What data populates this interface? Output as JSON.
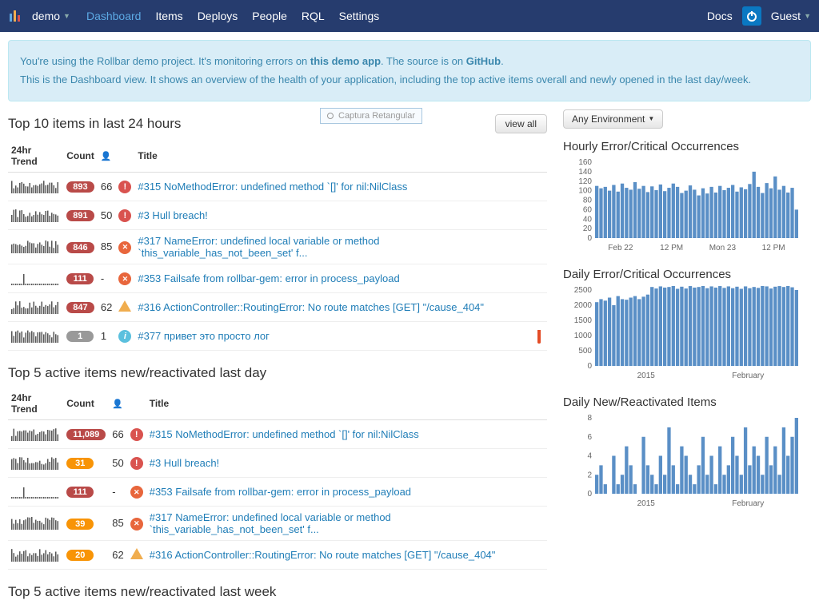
{
  "nav": {
    "project": "demo",
    "links": [
      "Dashboard",
      "Items",
      "Deploys",
      "People",
      "RQL",
      "Settings"
    ],
    "active": "Dashboard",
    "docs": "Docs",
    "user": "Guest"
  },
  "banner": {
    "line1_pre": "You're using the Rollbar demo project. It's monitoring errors on ",
    "line1_link1": "this demo app",
    "line1_mid": ". The source is on ",
    "line1_link2": "GitHub",
    "line1_post": ".",
    "line2": "This is the Dashboard view. It shows an overview of the health of your application, including the top active items overall and newly opened in the last day/week."
  },
  "capture_box": "Captura Retangular",
  "sections": {
    "top10_title": "Top 10 items in last 24 hours",
    "view_all": "view all",
    "top5day_title": "Top 5 active items new/reactivated last day",
    "top5week_title": "Top 5 active items new/reactivated last week"
  },
  "columns": {
    "trend": "24hr Trend",
    "count": "Count",
    "title": "Title"
  },
  "env_selector": "Any Environment",
  "top10": [
    {
      "count": "893",
      "badge": "red",
      "people": "66",
      "level": "crit",
      "title": "#315 NoMethodError: undefined method `[]' for nil:NilClass",
      "lang": "ruby"
    },
    {
      "count": "891",
      "badge": "red",
      "people": "50",
      "level": "crit",
      "title": "#3 Hull breach!",
      "lang": "ruby"
    },
    {
      "count": "846",
      "badge": "red",
      "people": "85",
      "level": "err",
      "title": "#317 NameError: undefined local variable or method `this_variable_has_not_been_set' f...",
      "lang": "ruby"
    },
    {
      "count": "111",
      "badge": "red",
      "people": "-",
      "level": "err",
      "title": "#353 Failsafe from rollbar-gem: error in process_payload",
      "lang": ""
    },
    {
      "count": "847",
      "badge": "red",
      "people": "62",
      "level": "warn",
      "title": "#316 ActionController::RoutingError: No route matches [GET] \"/cause_404\"",
      "lang": "ruby"
    },
    {
      "count": "1",
      "badge": "gray",
      "people": "1",
      "level": "info",
      "title": "#377 привет это просто лог",
      "lang": "js"
    }
  ],
  "top5day": [
    {
      "count": "11,089",
      "badge": "red",
      "people": "66",
      "level": "crit",
      "title": "#315 NoMethodError: undefined method `[]' for nil:NilClass",
      "lang": "ruby"
    },
    {
      "count": "31",
      "badge": "orange",
      "people": "50",
      "level": "crit",
      "title": "#3 Hull breach!",
      "lang": "ruby"
    },
    {
      "count": "111",
      "badge": "red",
      "people": "-",
      "level": "err",
      "title": "#353 Failsafe from rollbar-gem: error in process_payload",
      "lang": ""
    },
    {
      "count": "39",
      "badge": "orange",
      "people": "85",
      "level": "err",
      "title": "#317 NameError: undefined local variable or method `this_variable_has_not_been_set' f...",
      "lang": "ruby"
    },
    {
      "count": "20",
      "badge": "orange",
      "people": "62",
      "level": "warn",
      "title": "#316 ActionController::RoutingError: No route matches [GET] \"/cause_404\"",
      "lang": "ruby"
    }
  ],
  "charts": {
    "hourly_title": "Hourly Error/Critical Occurrences",
    "daily_title": "Daily Error/Critical Occurrences",
    "newitems_title": "Daily New/Reactivated Items"
  },
  "chart_data": [
    {
      "type": "bar",
      "title": "Hourly Error/Critical Occurrences",
      "ylim": [
        0,
        160
      ],
      "yticks": [
        0,
        20,
        40,
        60,
        80,
        100,
        120,
        140,
        160
      ],
      "xticks": [
        "Feb 22",
        "12 PM",
        "Mon 23",
        "12 PM"
      ],
      "values": [
        110,
        105,
        108,
        100,
        112,
        98,
        115,
        106,
        102,
        118,
        104,
        110,
        97,
        109,
        101,
        113,
        99,
        106,
        115,
        108,
        95,
        100,
        111,
        102,
        90,
        105,
        94,
        108,
        96,
        110,
        101,
        106,
        112,
        98,
        107,
        103,
        114,
        140,
        108,
        95,
        116,
        105,
        130,
        102,
        110,
        96,
        106,
        60
      ]
    },
    {
      "type": "bar",
      "title": "Daily Error/Critical Occurrences",
      "ylim": [
        0,
        2500
      ],
      "yticks": [
        0,
        500,
        1000,
        1500,
        2000,
        2500
      ],
      "xticks": [
        "2015",
        "February"
      ],
      "values": [
        2100,
        2200,
        2150,
        2250,
        2000,
        2300,
        2200,
        2180,
        2250,
        2300,
        2200,
        2280,
        2350,
        2600,
        2550,
        2620,
        2580,
        2600,
        2650,
        2540,
        2610,
        2550,
        2630,
        2580,
        2600,
        2640,
        2560,
        2620,
        2580,
        2630,
        2570,
        2620,
        2560,
        2610,
        2540,
        2620,
        2560,
        2600,
        2570,
        2640,
        2620,
        2550,
        2610,
        2630,
        2600,
        2640,
        2590,
        2500
      ]
    },
    {
      "type": "bar",
      "title": "Daily New/Reactivated Items",
      "ylim": [
        0,
        8
      ],
      "yticks": [
        0,
        2,
        4,
        6,
        8
      ],
      "xticks": [
        "2015",
        "February"
      ],
      "values": [
        2,
        3,
        1,
        0,
        4,
        1,
        2,
        5,
        3,
        1,
        0,
        6,
        3,
        2,
        1,
        4,
        2,
        7,
        3,
        1,
        5,
        4,
        2,
        1,
        3,
        6,
        2,
        4,
        1,
        5,
        2,
        3,
        6,
        4,
        2,
        7,
        3,
        5,
        4,
        2,
        6,
        3,
        5,
        2,
        7,
        4,
        6,
        8
      ]
    }
  ]
}
